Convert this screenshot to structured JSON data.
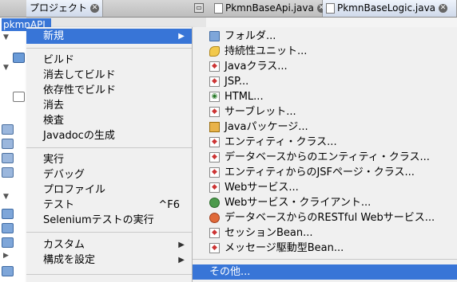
{
  "tabs": {
    "project": "プロジェクト",
    "file1": "PkmnBaseApi.java",
    "file2": "PkmnBaseLogic.java",
    "close_glyph": "✕",
    "minimize_glyph": "▭"
  },
  "tree": {
    "selected": "pkmnAPI"
  },
  "menu": {
    "items": [
      {
        "label": "新規",
        "arrow": "▶"
      },
      {
        "label": "ビルド"
      },
      {
        "label": "消去してビルド"
      },
      {
        "label": "依存性でビルド"
      },
      {
        "label": "消去"
      },
      {
        "label": "検査"
      },
      {
        "label": "Javadocの生成"
      },
      {
        "label": "実行"
      },
      {
        "label": "デバッグ"
      },
      {
        "label": "プロファイル"
      },
      {
        "label": "テスト",
        "shortcut": "^F6"
      },
      {
        "label": "Seleniumテストの実行"
      },
      {
        "label": "カスタム",
        "arrow": "▶"
      },
      {
        "label": "構成を設定",
        "arrow": "▶"
      }
    ]
  },
  "submenu": {
    "items": [
      {
        "label": "フォルダ...",
        "icon": "folder-icon"
      },
      {
        "label": "持続性ユニット...",
        "icon": "persistence-unit-icon"
      },
      {
        "label": "Javaクラス...",
        "icon": "java-class-icon"
      },
      {
        "label": "JSP...",
        "icon": "jsp-icon"
      },
      {
        "label": "HTML...",
        "icon": "html-icon"
      },
      {
        "label": "サーブレット...",
        "icon": "servlet-icon"
      },
      {
        "label": "Javaパッケージ...",
        "icon": "java-package-icon"
      },
      {
        "label": "エンティティ・クラス...",
        "icon": "entity-class-icon"
      },
      {
        "label": "データベースからのエンティティ・クラス...",
        "icon": "entity-from-db-icon"
      },
      {
        "label": "エンティティからのJSFページ・クラス...",
        "icon": "jsf-from-entity-icon"
      },
      {
        "label": "Webサービス...",
        "icon": "web-service-icon"
      },
      {
        "label": "Webサービス・クライアント...",
        "icon": "web-service-client-icon"
      },
      {
        "label": "データベースからのRESTful Webサービス...",
        "icon": "restful-service-icon"
      },
      {
        "label": "セッションBean...",
        "icon": "session-bean-icon"
      },
      {
        "label": "メッセージ駆動型Bean...",
        "icon": "message-bean-icon"
      },
      {
        "label": "その他..."
      }
    ]
  }
}
